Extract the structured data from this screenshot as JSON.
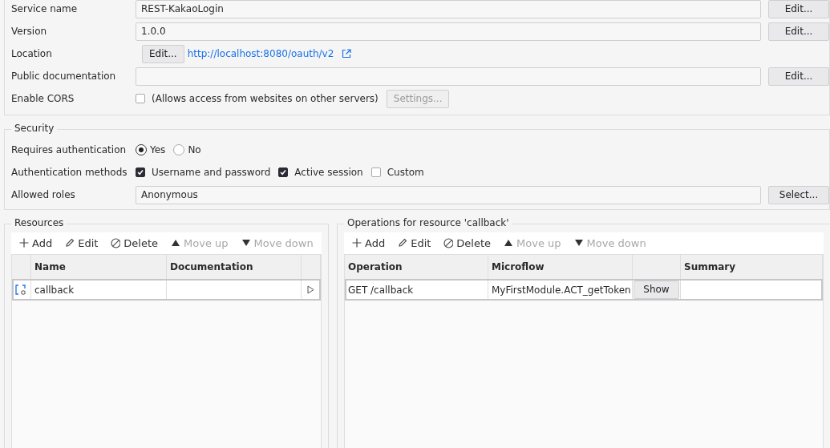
{
  "general": {
    "rows": [
      {
        "kind": "field",
        "label": "Service name",
        "value": "REST-KakaoLogin",
        "button": "Edit..."
      },
      {
        "kind": "field",
        "label": "Version",
        "value": "1.0.0",
        "button": "Edit..."
      },
      {
        "kind": "link",
        "label": "Location",
        "button": "Edit...",
        "url": "http://localhost:8080/oauth/v2"
      },
      {
        "kind": "field",
        "label": "Public documentation",
        "button": "Edit..."
      },
      {
        "kind": "checkbox",
        "label": "Enable CORS",
        "checked": false,
        "text": "(Allows access from websites on other servers)",
        "button": "Settings...",
        "button_disabled": true
      }
    ]
  },
  "security": {
    "title": "Security",
    "requires_authentication": {
      "label": "Requires authentication",
      "options": [
        {
          "label": "Yes",
          "selected": true
        },
        {
          "label": "No",
          "selected": false
        }
      ]
    },
    "authentication_methods": {
      "label": "Authentication methods",
      "options": [
        {
          "label": "Username and password",
          "checked": true
        },
        {
          "label": "Active session",
          "checked": true
        },
        {
          "label": "Custom",
          "checked": false
        }
      ]
    },
    "allowed_roles": {
      "label": "Allowed roles",
      "value": "Anonymous",
      "button": "Select..."
    }
  },
  "resources": {
    "title": "Resources",
    "toolbar": [
      {
        "label": "Add",
        "disabled": false
      },
      {
        "label": "Edit",
        "disabled": false
      },
      {
        "label": "Delete",
        "disabled": false
      },
      {
        "label": "Move up",
        "disabled": true
      },
      {
        "label": "Move down",
        "disabled": true
      }
    ],
    "columns": [
      "Name",
      "Documentation"
    ],
    "rows": [
      {
        "name": "callback",
        "selected": true
      }
    ]
  },
  "operations": {
    "title": "Operations for resource 'callback'",
    "toolbar": [
      {
        "label": "Add",
        "disabled": false
      },
      {
        "label": "Edit",
        "disabled": false
      },
      {
        "label": "Delete",
        "disabled": false
      },
      {
        "label": "Move up",
        "disabled": true
      },
      {
        "label": "Move down",
        "disabled": true
      }
    ],
    "columns": [
      "Operation",
      "Microflow",
      "Summary"
    ],
    "rows": [
      {
        "operation": "GET /callback",
        "microflow": "MyFirstModule.ACT_getToken",
        "button": "Show",
        "selected": true
      }
    ]
  }
}
